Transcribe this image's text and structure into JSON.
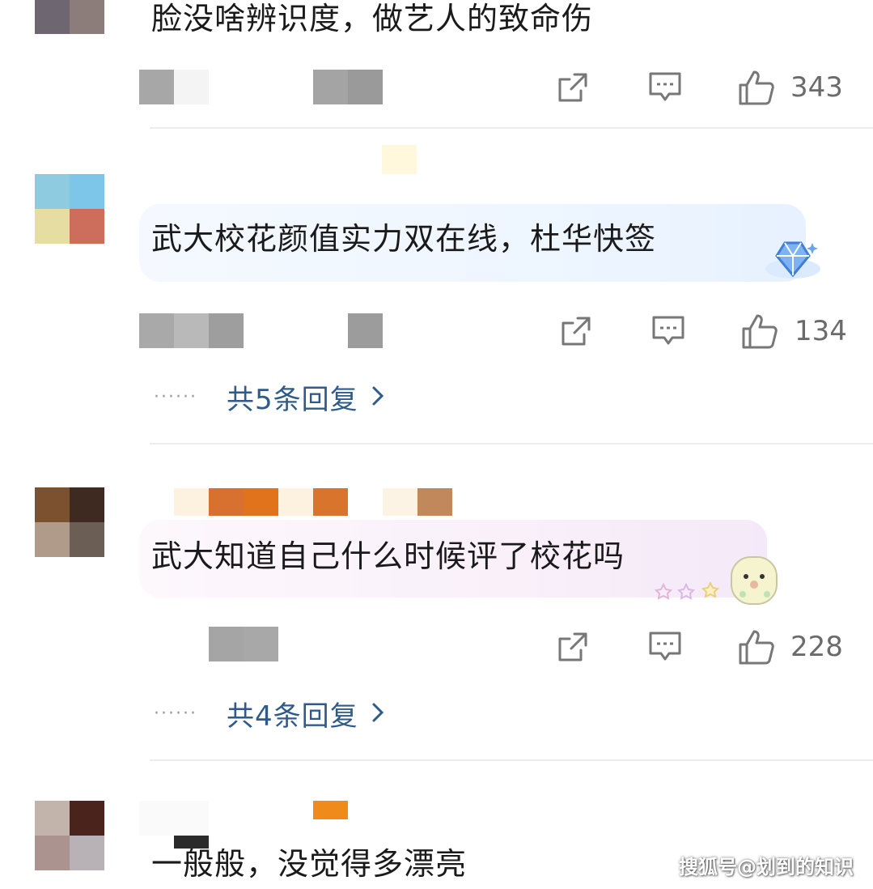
{
  "comments": [
    {
      "text": "脸没啥辨识度，做艺人的致命伤",
      "likes": "343",
      "avatar_colors": [
        "#6e6670",
        "#8d7d7a",
        "#ffffff",
        "#ffffff"
      ],
      "meta_colors": [
        "#a7a7a7",
        "#f3f3f3",
        "#ffffff",
        "#ffffff",
        "#ffffff",
        "#a4a4a4",
        "#9a9a9a"
      ]
    },
    {
      "text": "武大校花颜值实力双在线，杜华快签",
      "likes": "134",
      "replies": "共5条回复",
      "avatar_colors": [
        "#8ecbe0",
        "#7ec5ea",
        "#e6dda3",
        "#cd6d5b"
      ],
      "meta_colors": [
        "#a9a9a9",
        "#b9b9b9",
        "#9e9e9e",
        "#ffffff",
        "#f8f8f8",
        "#ffffff",
        "#9c9c9c"
      ]
    },
    {
      "text": "武大知道自己什么时候评了校花吗",
      "likes": "228",
      "replies": "共4条回复",
      "avatar_colors": [
        "#7b5130",
        "#3e2a21",
        "#b09a8a",
        "#6a5e55"
      ],
      "name_colors": [
        "#fdf1df",
        "#d8702f",
        "#e2731d",
        "#fdf1df",
        "#d9742c",
        "#ffffff",
        "#fdf3e4",
        "#c1895b"
      ],
      "meta_colors": [
        "#ffffff",
        "#a5a5a5",
        "#a8a8a8"
      ]
    },
    {
      "text": "一般般，没觉得多漂亮",
      "avatar_colors": [
        "#c2b3ab",
        "#4a231d",
        "#ab948f",
        "#b8b2b6"
      ]
    }
  ],
  "watermark": "搜狐号@划到的知识",
  "colors": {
    "link": "#2f5a8c",
    "bubble_blue": "#eef6ff",
    "bubble_pink": "#f9f0fa"
  }
}
